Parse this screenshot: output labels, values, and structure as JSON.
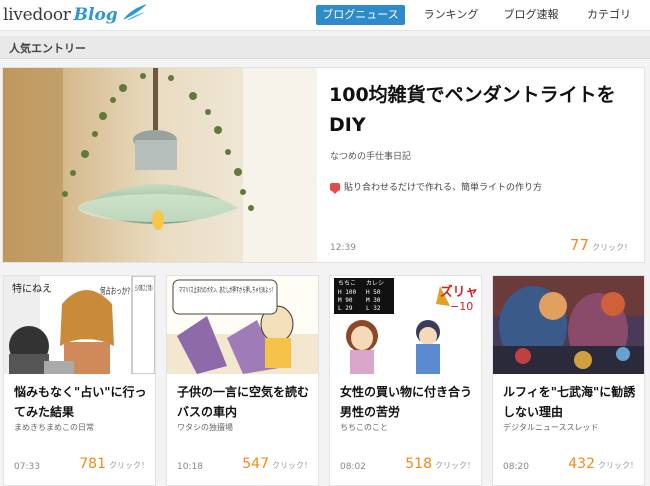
{
  "header": {
    "logo_main": "livedoor",
    "logo_sub": "Blog",
    "nav": [
      {
        "label": "ブログニュース",
        "active": true
      },
      {
        "label": "ランキング",
        "active": false
      },
      {
        "label": "ブログ速報",
        "active": false
      },
      {
        "label": "カテゴリ",
        "active": false
      }
    ]
  },
  "section": {
    "title": "人気エントリー"
  },
  "featured": {
    "title": "100均雑貨でペンダントライトをDIY",
    "source": "なつめの手仕事日記",
    "snippet": "貼り合わせるだけで作れる、簡単ライトの作り方",
    "time": "12:39",
    "count": "77",
    "click_label": "クリック！"
  },
  "cards": [
    {
      "title": "悩みもなく\"占い\"に行ってみた結果",
      "source": "まめきちまめこの日常",
      "time": "07:33",
      "count": "781",
      "click_label": "クリック！"
    },
    {
      "title": "子供の一言に空気を読むバスの車内",
      "source": "ワタシの独擅場",
      "time": "10:18",
      "count": "547",
      "click_label": "クリック！"
    },
    {
      "title": "女性の買い物に付き合う男性の苦労",
      "source": "ちちこのこと",
      "time": "08:02",
      "count": "518",
      "click_label": "クリック！"
    },
    {
      "title": "ルフィを\"七武海\"に勧誘しない理由",
      "source": "デジタルニューススレッド",
      "time": "08:20",
      "count": "432",
      "click_label": "クリック！"
    }
  ],
  "images": {
    "card1_text": "特にねえ",
    "card1_speech": "何占おっか?",
    "card1_sign": "占いの館にたどり着い",
    "card2_speech": "ママ!バス止まれのボタン、あたしが押すから押しちゃだめよっ!",
    "card3_status": [
      "ちちこ",
      "カレシ",
      "H 100",
      "H 50",
      "M 90",
      "M 30",
      "L 29",
      "L 32"
    ],
    "card3_minus": "−10",
    "card3_sfx": "ズリャ"
  },
  "colors": {
    "accent": "#2d8bc9",
    "count": "#f08a1c",
    "snippet_icon": "#e04a4a"
  }
}
